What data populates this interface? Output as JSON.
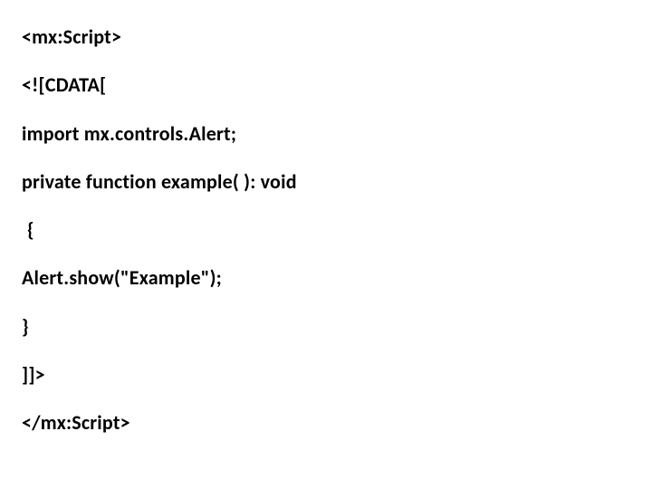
{
  "code": {
    "l1": "<mx:Script>",
    "l2": "<![CDATA[",
    "l3": "import mx.controls.Alert;",
    "l4": "private function example( ): void",
    "l5": " {",
    "l6": "Alert.show(\"Example\");",
    "l7": "}",
    "l8": "]]>",
    "l9": "</mx:Script>"
  }
}
